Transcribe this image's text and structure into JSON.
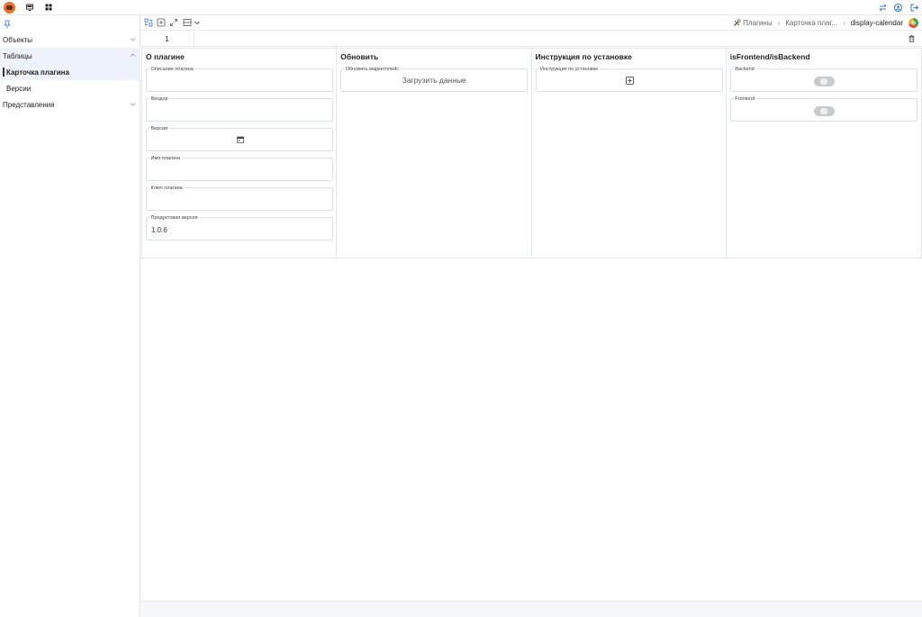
{
  "sidebar": {
    "groups": [
      {
        "label": "Объекты"
      },
      {
        "label": "Таблицы"
      },
      {
        "label": "Представления"
      }
    ],
    "items": [
      {
        "label": "Карточка плагина"
      },
      {
        "label": "Версии"
      }
    ]
  },
  "breadcrumb": {
    "items": [
      "Плагины",
      "Карточка плаг...",
      "display-calendar"
    ]
  },
  "record": {
    "number": "1"
  },
  "panels": {
    "about": {
      "title": "О плагине",
      "fields": [
        {
          "label": "Описание плагина",
          "value": ""
        },
        {
          "label": "Вендор",
          "value": ""
        },
        {
          "label": "Версии",
          "value": ""
        },
        {
          "label": "Имя плагина",
          "value": ""
        },
        {
          "label": "Ключ плагина",
          "value": ""
        },
        {
          "label": "Продуктовая версия",
          "value": "1.0.6"
        }
      ]
    },
    "update": {
      "title": "Обновить",
      "field_label": "Обновить маркетплейс",
      "button_label": "Загрузить данные"
    },
    "install": {
      "title": "Инструкция по установке",
      "field_label": "Инструкция по установке"
    },
    "flags": {
      "title": "isFrontend/isBackend",
      "fields": [
        {
          "label": "Backend",
          "checked": false
        },
        {
          "label": "Frontend",
          "checked": false
        }
      ]
    }
  },
  "icons": {
    "logo": "app-logo",
    "monitor": "monitor-icon",
    "grid": "apps-grid-icon",
    "pin": "pin-icon",
    "transfer": "transfer-icon",
    "user": "user-circle-icon",
    "logout": "logout-icon",
    "trash": "trash-icon"
  },
  "colors": {
    "accent": "#3a73d8",
    "selected_bg": "#eef2fa",
    "toggle_off": "#c9cacc",
    "logo": "#e8732a"
  }
}
